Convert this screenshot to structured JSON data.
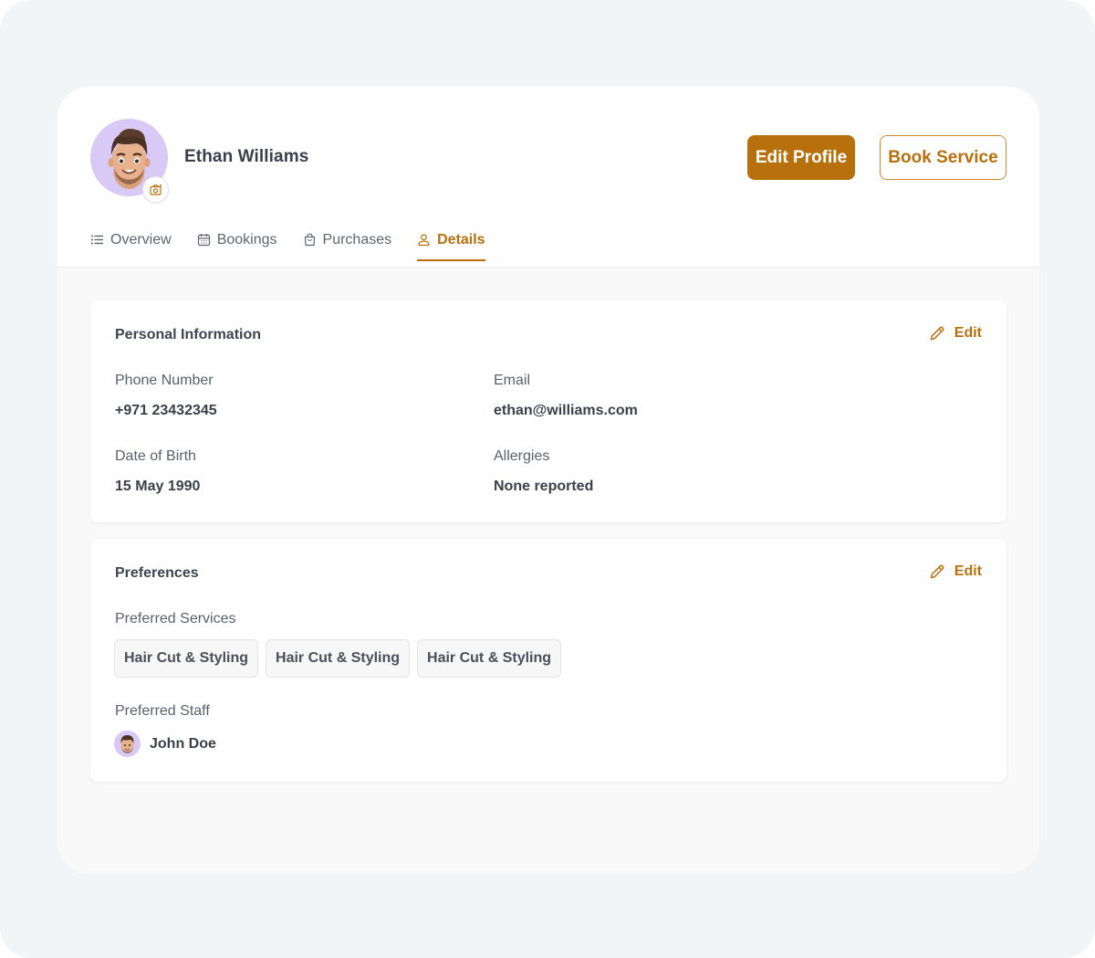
{
  "profile": {
    "name": "Ethan Williams"
  },
  "actions": {
    "edit_profile": "Edit Profile",
    "book_service": "Book Service"
  },
  "tabs": [
    {
      "label": "Overview",
      "icon": "list-icon"
    },
    {
      "label": "Bookings",
      "icon": "calendar-icon"
    },
    {
      "label": "Purchases",
      "icon": "shopping-bag-icon"
    },
    {
      "label": "Details",
      "icon": "user-icon",
      "active": true
    }
  ],
  "personal": {
    "title": "Personal Information",
    "edit_label": "Edit",
    "phone_label": "Phone Number",
    "phone_value": "+971 23432345",
    "email_label": "Email",
    "email_value": "ethan@williams.com",
    "dob_label": "Date of Birth",
    "dob_value": "15 May 1990",
    "allergies_label": "Allergies",
    "allergies_value": "None reported"
  },
  "preferences": {
    "title": "Preferences",
    "edit_label": "Edit",
    "services_label": "Preferred Services",
    "services": [
      "Hair Cut & Styling",
      "Hair Cut & Styling",
      "Hair Cut & Styling"
    ],
    "staff_label": "Preferred Staff",
    "staff_name": "John Doe"
  },
  "colors": {
    "accent": "#b8700c",
    "avatar_bg": "#d9c9f6",
    "page_bg": "#f3f4f6"
  }
}
